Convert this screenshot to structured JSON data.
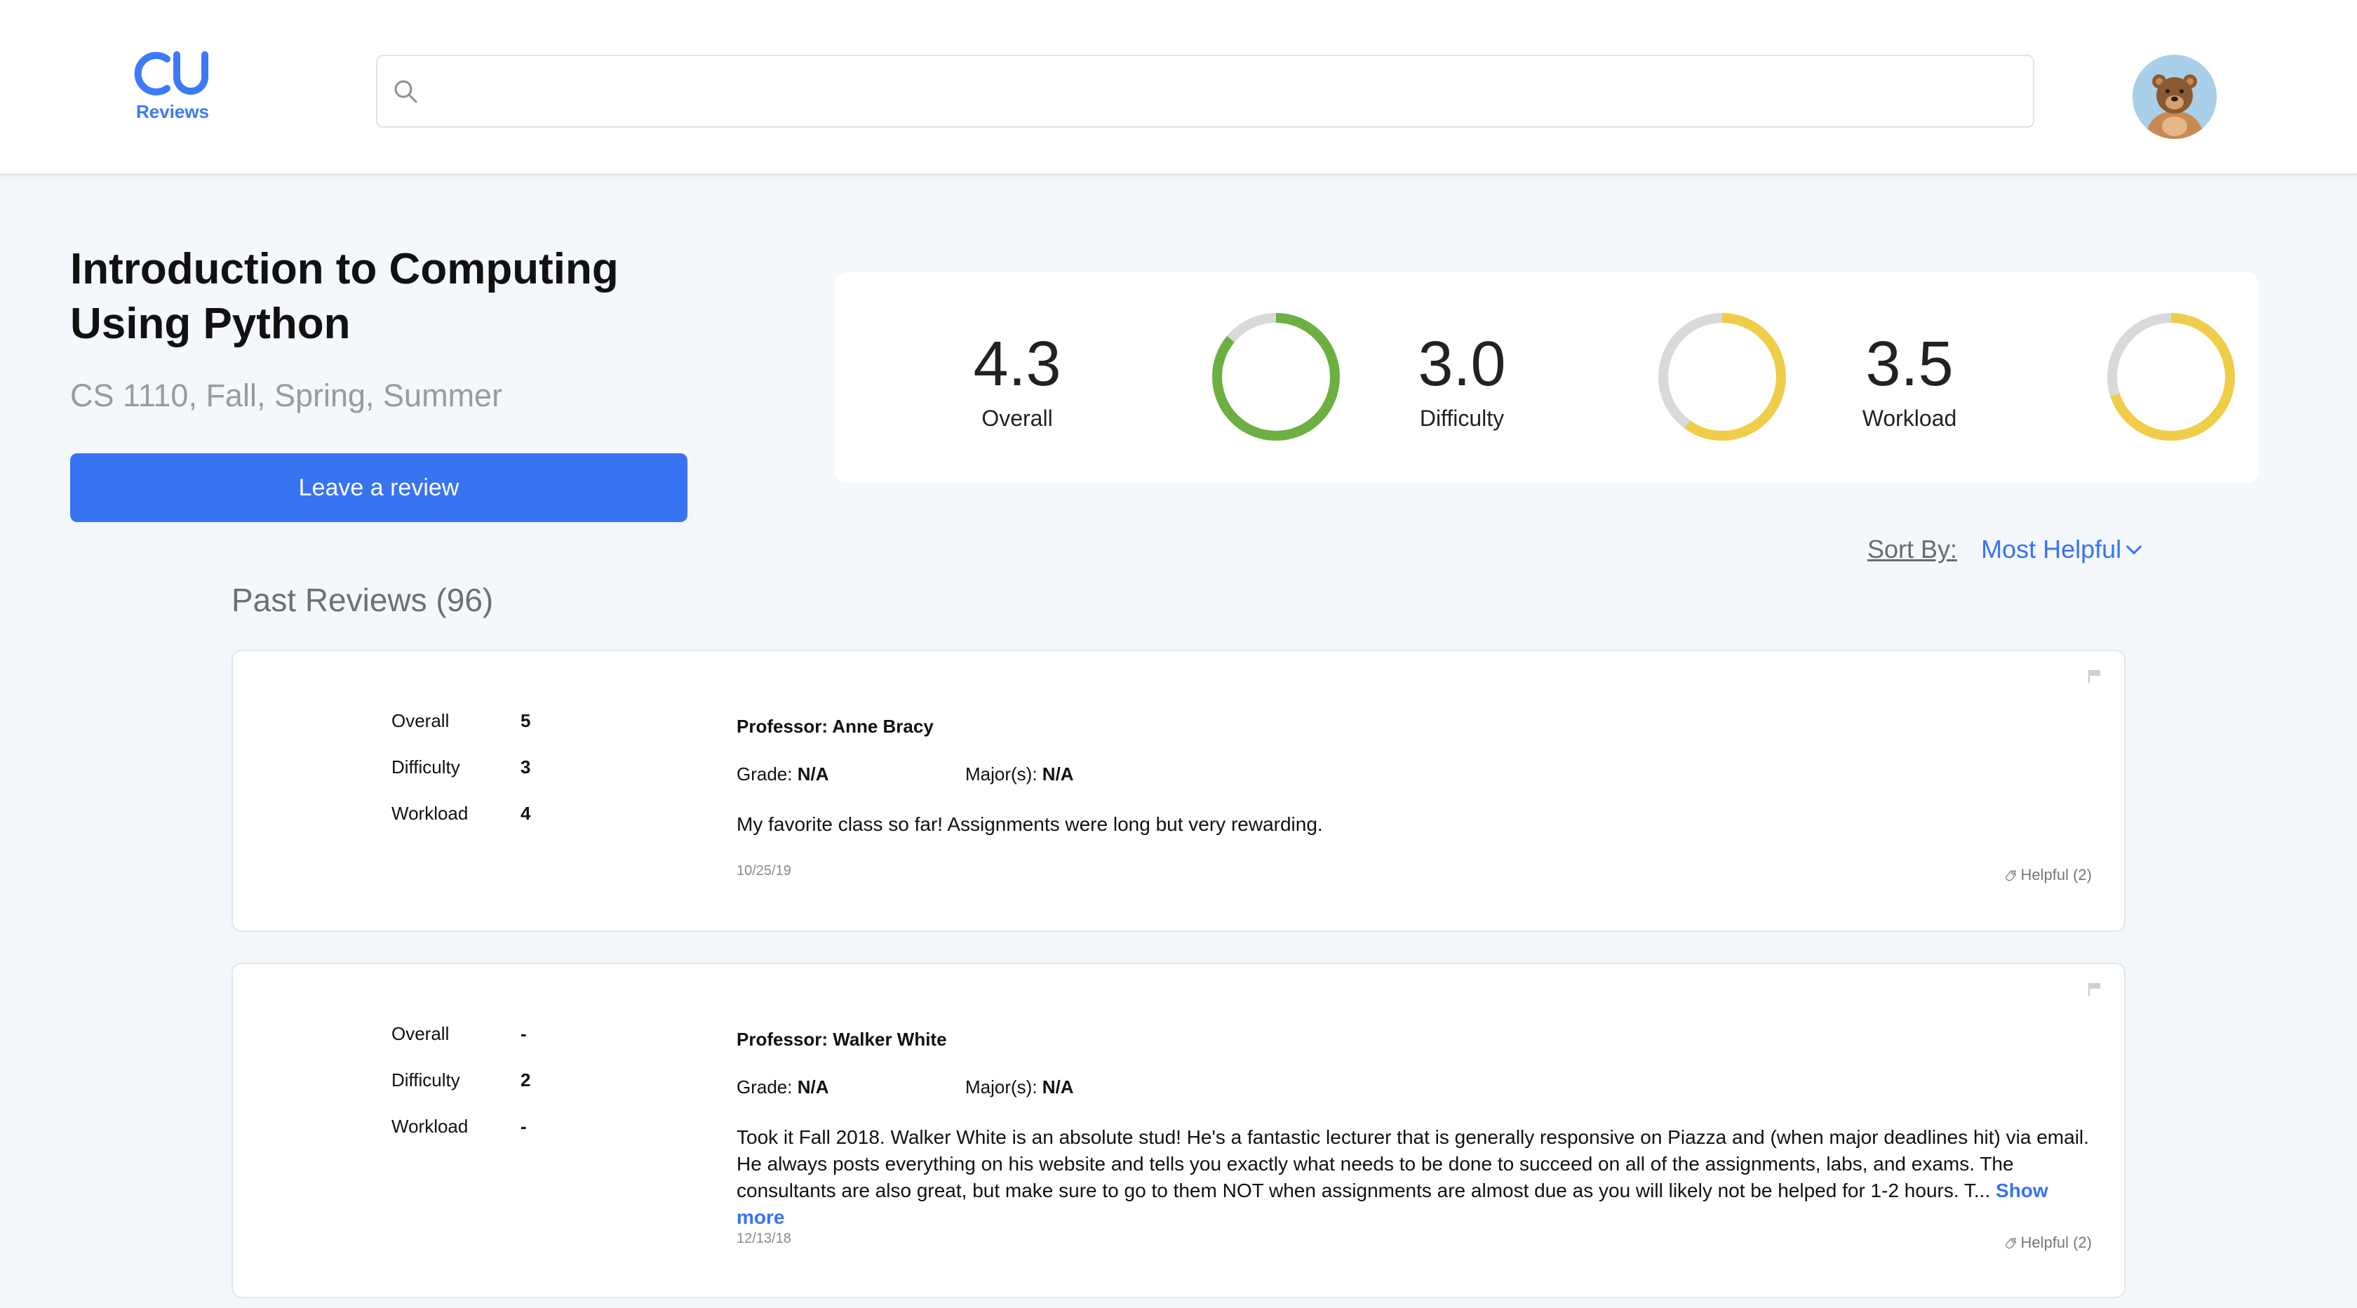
{
  "header": {
    "logo_top": "CU",
    "logo_bottom": "Reviews",
    "search_placeholder": ""
  },
  "course": {
    "title": "Introduction to Computing Using Python",
    "subtitle": "CS 1110, Fall, Spring, Summer",
    "leave_review_label": "Leave a review"
  },
  "ratings": [
    {
      "value": "4.3",
      "label": "Overall",
      "fraction": 0.86,
      "color": "#6bb041"
    },
    {
      "value": "3.0",
      "label": "Difficulty",
      "fraction": 0.6,
      "color": "#f0cd48"
    },
    {
      "value": "3.5",
      "label": "Workload",
      "fraction": 0.7,
      "color": "#f0cd48"
    }
  ],
  "sort": {
    "label": "Sort By:",
    "value": "Most Helpful"
  },
  "past_reviews_title": "Past Reviews (96)",
  "reviews": [
    {
      "overall_label": "Overall",
      "overall": "5",
      "difficulty_label": "Difficulty",
      "difficulty": "3",
      "workload_label": "Workload",
      "workload": "4",
      "professor": "Professor: Anne Bracy",
      "grade_label": "Grade:",
      "grade": "N/A",
      "major_label": "Major(s):",
      "major": "N/A",
      "text": "My favorite class so far! Assignments were long but very rewarding.",
      "date": "10/25/19",
      "helpful": "Helpful (2)"
    },
    {
      "overall_label": "Overall",
      "overall": "-",
      "difficulty_label": "Difficulty",
      "difficulty": "2",
      "workload_label": "Workload",
      "workload": "-",
      "professor": "Professor: Walker White",
      "grade_label": "Grade:",
      "grade": "N/A",
      "major_label": "Major(s):",
      "major": "N/A",
      "text": "Took it Fall 2018. Walker White is an absolute stud! He's a fantastic lecturer that is generally responsive on Piazza and (when major deadlines hit) via email. He always posts everything on his website and tells you exactly what needs to be done to succeed on all of the assignments, labs, and exams. The consultants are also great, but make sure to go to them NOT when assignments are almost due as you will likely not be helped for 1-2 hours. T...",
      "show_more": "Show more",
      "date": "12/13/18",
      "helpful": "Helpful (2)"
    }
  ]
}
